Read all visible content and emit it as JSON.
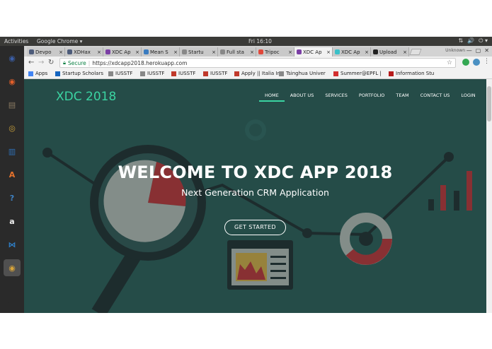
{
  "desktop": {
    "activities": "Activities",
    "app_name": "Google Chrome ▾",
    "clock": "Fri 16:10",
    "tray": [
      "⇅",
      "🔊",
      "⏻ ▾"
    ]
  },
  "launcher": [
    {
      "name": "chrome-remote-icon",
      "glyph": "◉",
      "color": "#3b5fa8"
    },
    {
      "name": "firefox-icon",
      "glyph": "◉",
      "color": "#e25f2a"
    },
    {
      "name": "files-icon",
      "glyph": "▤",
      "color": "#8a7b62"
    },
    {
      "name": "rhythmbox-icon",
      "glyph": "◎",
      "color": "#c9a13b"
    },
    {
      "name": "writer-icon",
      "glyph": "▥",
      "color": "#2f70b7"
    },
    {
      "name": "software-center-icon",
      "glyph": "A",
      "color": "#e4722c"
    },
    {
      "name": "help-icon",
      "glyph": "?",
      "color": "#3f82c4"
    },
    {
      "name": "amazon-icon",
      "glyph": "a",
      "color": "#f0f0f0"
    },
    {
      "name": "vscode-icon",
      "glyph": "⋈",
      "color": "#2f7fc7"
    },
    {
      "name": "chrome-icon",
      "glyph": "◉",
      "color": "#d9a53a"
    },
    {
      "name": "app-grid-icon",
      "glyph": "⋮⋮⋮",
      "color": "#2a2a2a"
    }
  ],
  "tabs": [
    {
      "title": "Devpo",
      "color": "#4d5c7a"
    },
    {
      "title": "XDHax",
      "color": "#4d5c7a"
    },
    {
      "title": "XDC Ap",
      "color": "#7b3fa5"
    },
    {
      "title": "Mean S",
      "color": "#3a7cc0"
    },
    {
      "title": "Startu",
      "color": "#888888"
    },
    {
      "title": "Full sta",
      "color": "#888888"
    },
    {
      "title": "Tripoc",
      "color": "#e0483b"
    },
    {
      "title": "XDC Ap",
      "color": "#7b3fa5"
    },
    {
      "title": "XDC Ap",
      "color": "#3ac0c8"
    },
    {
      "title": "Upload",
      "color": "#222222"
    }
  ],
  "profile": "Unknown",
  "toolbar": {
    "secure": "Secure",
    "url": "https://xdcapp2018.herokuapp.com"
  },
  "bookmarks": [
    {
      "label": "Apps",
      "color": "#4285f4"
    },
    {
      "label": "Startup Scholars",
      "color": "#1565c0"
    },
    {
      "label": "IUSSTF",
      "color": "#888888"
    },
    {
      "label": "IUSSTF",
      "color": "#888888"
    },
    {
      "label": "IUSSTF",
      "color": "#c0392b"
    },
    {
      "label": "IUSSTF",
      "color": "#c0392b"
    },
    {
      "label": "Apply || Italia Inn",
      "color": "#c0392b"
    },
    {
      "label": "Tsinghua Univer",
      "color": "#888888"
    },
    {
      "label": "Summer@EPFL |",
      "color": "#d32f2f"
    },
    {
      "label": "Information Stu",
      "color": "#b71c1c"
    }
  ],
  "site": {
    "brand": "XDC 2018",
    "nav": [
      "HOME",
      "ABOUT US",
      "SERVICES",
      "PORTFOLIO",
      "TEAM",
      "CONTACT US",
      "LOGIN"
    ],
    "hero_title": "WELCOME TO XDC APP 2018",
    "hero_subtitle": "Next Generation CRM Application",
    "cta": "GET STARTED"
  },
  "colors": {
    "accent": "#3bd4a2",
    "hero_bg": "#28504c",
    "red": "#c0262c"
  }
}
